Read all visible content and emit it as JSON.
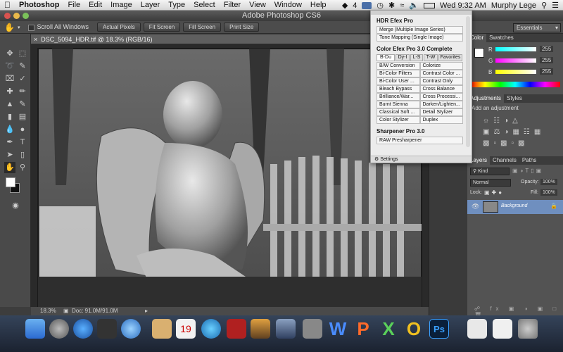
{
  "menubar": {
    "apple": "",
    "app": "Photoshop",
    "items": [
      "File",
      "Edit",
      "Image",
      "Layer",
      "Type",
      "Select",
      "Filter",
      "View",
      "Window",
      "Help"
    ],
    "clock": "Wed 9:32 AM",
    "user": "Murphy Lege",
    "badge": "4"
  },
  "window_title": "Adobe Photoshop CS6",
  "options": {
    "scroll_all": "Scroll All Windows",
    "actual_pixels": "Actual Pixels",
    "fit_screen": "Fit Screen",
    "fill_screen": "Fill Screen",
    "print_size": "Print Size",
    "workspace": "Essentials"
  },
  "document": {
    "tab": "DSC_5094_HDR.tif @ 18.3% (RGB/16)",
    "zoom": "18.3%",
    "doc_info": "Doc: 91.0M/91.0M"
  },
  "efex": {
    "hdr_title": "HDR Efex Pro",
    "hdr_items": [
      "Merge (Multiple Image Series)",
      "Tone Mapping (Single Image)"
    ],
    "color_title": "Color Efex Pro 3.0 Complete",
    "color_tabs": [
      "B-Du",
      "Dy-I",
      "L-S",
      "T-W",
      "Favorites"
    ],
    "color_items": [
      "B/W Conversion",
      "Colorize",
      "Bi-Color Filters",
      "Contrast Color ...",
      "Bi-Color User ...",
      "Contrast Only",
      "Bleach Bypass",
      "Cross Balance",
      "Brilliance/War...",
      "Cross Processi...",
      "Burnt Sienna",
      "Darken/Lighten...",
      "Classical Soft ...",
      "Detail Stylizer",
      "Color Stylizer",
      "Duplex"
    ],
    "sharpener_title": "Sharpener Pro 3.0",
    "sharpener_items": [
      "RAW Presharpener"
    ],
    "settings": "Settings"
  },
  "panels": {
    "color_tabs": [
      "Color",
      "Swatches"
    ],
    "r_label": "R",
    "g_label": "G",
    "b_label": "B",
    "r": "255",
    "g": "255",
    "b": "255",
    "adj_tabs": [
      "Adjustments",
      "Styles"
    ],
    "add_adjustment": "Add an adjustment",
    "layer_tabs": [
      "Layers",
      "Channels",
      "Paths"
    ],
    "kind": "Kind",
    "blend": "Normal",
    "opacity_label": "Opacity:",
    "opacity": "100%",
    "lock_label": "Lock:",
    "fill_label": "Fill:",
    "fill": "100%",
    "layer_name": "Background"
  },
  "colors": {
    "accent": "#2b6ad1",
    "panel": "#535353",
    "dock": "#2a3447"
  }
}
